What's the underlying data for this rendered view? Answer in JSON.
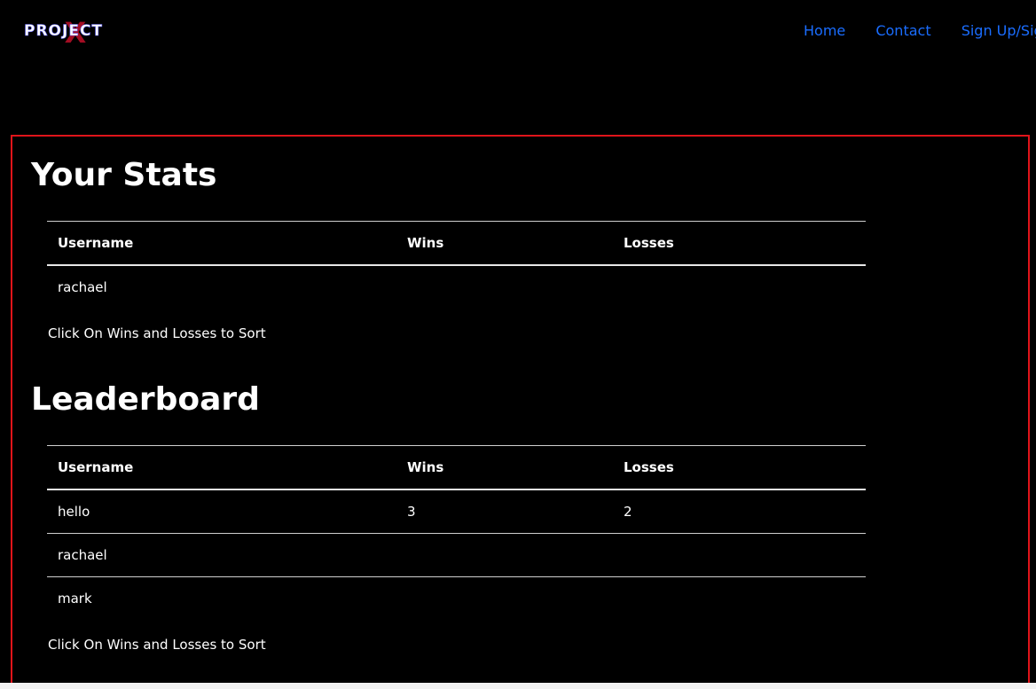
{
  "brand": {
    "logo_text": "PROJECT",
    "logo_accent": "X"
  },
  "nav": {
    "items": [
      {
        "label": "Home"
      },
      {
        "label": "Contact"
      },
      {
        "label": "Sign Up/Sign In"
      }
    ]
  },
  "stats": {
    "title": "Your Stats",
    "headers": [
      "Username",
      "Wins",
      "Losses"
    ],
    "rows": [
      {
        "username": "rachael",
        "wins": "",
        "losses": ""
      }
    ],
    "hint": "Click On Wins and Losses to Sort"
  },
  "leaderboard": {
    "title": "Leaderboard",
    "headers": [
      "Username",
      "Wins",
      "Losses"
    ],
    "rows": [
      {
        "username": "hello",
        "wins": "3",
        "losses": "2"
      },
      {
        "username": "rachael",
        "wins": "",
        "losses": ""
      },
      {
        "username": "mark",
        "wins": "",
        "losses": ""
      }
    ],
    "hint": "Click On Wins and Losses to Sort"
  },
  "colors": {
    "background": "#000000",
    "panel_border": "#e0141a",
    "link": "#1a6dff",
    "text": "#ffffff"
  }
}
